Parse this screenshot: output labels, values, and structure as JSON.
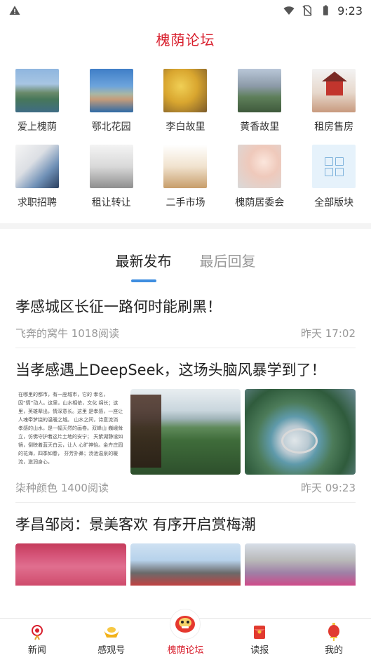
{
  "status_bar": {
    "time": "9:23",
    "icons": [
      "warning-icon",
      "wifi-icon",
      "no-sim-icon",
      "battery-icon"
    ]
  },
  "header": {
    "title": "槐荫论坛",
    "title_color": "#d81e2c"
  },
  "forums": [
    {
      "label": "爱上槐荫"
    },
    {
      "label": "鄂北花园"
    },
    {
      "label": "李白故里"
    },
    {
      "label": "黄香故里"
    },
    {
      "label": "租房售房"
    },
    {
      "label": "求职招聘"
    },
    {
      "label": "租让转让"
    },
    {
      "label": "二手市场"
    },
    {
      "label": "槐荫居委会"
    },
    {
      "label": "全部版块",
      "icon": "grid-icon"
    }
  ],
  "tabs": [
    {
      "label": "最新发布",
      "active": true
    },
    {
      "label": "最后回复",
      "active": false
    }
  ],
  "accent_color": "#3f8ee0",
  "posts": [
    {
      "title": "孝感城区长征一路何时能刷黑！",
      "author_reads": "飞奔的窝牛 1018阅读",
      "time": "昨天 17:02"
    },
    {
      "title": "当孝感遇上DeepSeek，这场头脑风暴学到了！",
      "author_reads": "柒种颜色 1400阅读",
      "time": "昨天 09:23",
      "image_text": "在哪里的都市，有一座城市，它的 孝名，因“情”动人。这里，山水相依，文化 绵长；这里，英雄辈出，情深意长。这里 是孝感，一座让人魂牵梦绕的温暖之城。 山水之间，诗意流淌 孝感的山水，是一幅天然的画卷。双峰山 巍峨耸立，仿佛守护着这片土地的安宁； 天紫湖静谧如镜，倒映着蓝天白云，让人 心旷神怡。金卉庄园的花海，四季如春， 芬芳扑鼻；汤池温泉的暖流，滋润身心，"
    },
    {
      "title": "孝昌邹岗：景美客欢 有序开启赏梅潮"
    }
  ],
  "bottom_nav": [
    {
      "label": "新闻",
      "icon": "knot-icon"
    },
    {
      "label": "感观号",
      "icon": "ingot-icon"
    },
    {
      "label": "槐荫论坛",
      "icon": "lion-icon",
      "active": true
    },
    {
      "label": "读报",
      "icon": "red-envelope-icon"
    },
    {
      "label": "我的",
      "icon": "lantern-icon"
    }
  ]
}
